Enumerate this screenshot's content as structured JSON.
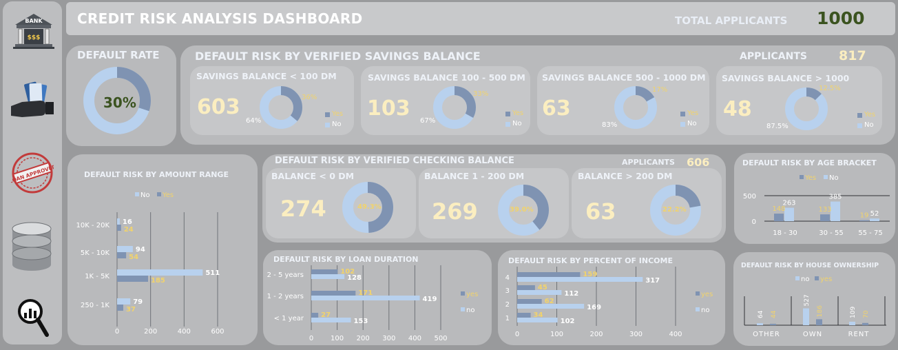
{
  "header": {
    "title": "CREDIT RISK ANALYSIS DASHBOARD",
    "total_label": "TOTAL APPLICANTS",
    "total_value": "1000"
  },
  "sidebar": {
    "bank_label": "BANK",
    "bank_symbol": "$$$",
    "stamp_text": "LOAN APPROVED"
  },
  "colors": {
    "no": "#b8d1ee",
    "yes": "#7f93b2",
    "yes_text": "#f1d36c",
    "value_text": "#fbeec0"
  },
  "default_rate": {
    "title": "DEFAULT RATE",
    "value": "30%"
  },
  "savings": {
    "title": "DEFAULT RISK BY VERIFIED SAVINGS BALANCE",
    "applicants_label": "APPLICANTS",
    "applicants_value": "817",
    "cards": [
      {
        "title": "SAVINGS BALANCE < 100 DM",
        "count": "603",
        "yes_pct": "36%",
        "no_pct": "64%",
        "yes_label": "Yes",
        "no_label": "No"
      },
      {
        "title": "SAVINGS BALANCE 100 - 500 DM",
        "count": "103",
        "yes_pct": "33%",
        "no_pct": "67%",
        "yes_label": "Yes",
        "no_label": "No"
      },
      {
        "title": "SAVINGS BALANCE 500 - 1000 DM",
        "count": "63",
        "yes_pct": "17%",
        "no_pct": "83%",
        "yes_label": "Yes",
        "no_label": "No"
      },
      {
        "title": "SAVINGS BALANCE > 1000",
        "count": "48",
        "yes_pct": "12.5%",
        "no_pct": "87.5%",
        "yes_label": "Yes",
        "no_label": "No"
      }
    ]
  },
  "checking": {
    "title": "DEFAULT RISK BY VERIFIED CHECKING BALANCE",
    "applicants_label": "APPLICANTS",
    "applicants_value": "606",
    "cards": [
      {
        "title": "BALANCE < 0 DM",
        "count": "274",
        "yes_pct": "49.3%"
      },
      {
        "title": "BALANCE 1 - 200 DM",
        "count": "269",
        "yes_pct": "39.0%"
      },
      {
        "title": "BALANCE > 200 DM",
        "count": "63",
        "yes_pct": "22.2%"
      }
    ]
  },
  "amount": {
    "title": "DEFAULT RISK BY AMOUNT RANGE",
    "legend_no": "No",
    "legend_yes": "Yes"
  },
  "duration": {
    "title": "DEFAULT RISK BY LOAN DURATION",
    "legend_yes": "yes",
    "legend_no": "no"
  },
  "income": {
    "title": "DEFAULT RISK BY PERCENT OF INCOME",
    "legend_yes": "yes",
    "legend_no": "no"
  },
  "age": {
    "title": "DEFAULT RISK BY AGE BRACKET",
    "legend_yes": "Yes",
    "legend_no": "No"
  },
  "house": {
    "title": "DEFAULT RISK BY HOUSE OWNERSHIP",
    "legend_no": "no",
    "legend_yes": "yes"
  },
  "chart_data": [
    {
      "type": "pie",
      "title": "DEFAULT RATE",
      "labels": [
        "Yes",
        "No"
      ],
      "values": [
        30,
        70
      ]
    },
    {
      "type": "pie",
      "title": "SAVINGS BALANCE < 100 DM",
      "labels": [
        "Yes",
        "No"
      ],
      "values": [
        36,
        64
      ]
    },
    {
      "type": "pie",
      "title": "SAVINGS BALANCE 100 - 500 DM",
      "labels": [
        "Yes",
        "No"
      ],
      "values": [
        33,
        67
      ]
    },
    {
      "type": "pie",
      "title": "SAVINGS BALANCE 500 - 1000 DM",
      "labels": [
        "Yes",
        "No"
      ],
      "values": [
        17,
        83
      ]
    },
    {
      "type": "pie",
      "title": "SAVINGS BALANCE > 1000",
      "labels": [
        "Yes",
        "No"
      ],
      "values": [
        12.5,
        87.5
      ]
    },
    {
      "type": "pie",
      "title": "BALANCE < 0 DM",
      "labels": [
        "Yes",
        "No"
      ],
      "values": [
        49.3,
        50.7
      ]
    },
    {
      "type": "pie",
      "title": "BALANCE 1 - 200 DM",
      "labels": [
        "Yes",
        "No"
      ],
      "values": [
        39.0,
        61.0
      ]
    },
    {
      "type": "pie",
      "title": "BALANCE > 200 DM",
      "labels": [
        "Yes",
        "No"
      ],
      "values": [
        22.2,
        77.8
      ]
    },
    {
      "type": "bar",
      "orientation": "horizontal",
      "title": "DEFAULT RISK BY AMOUNT RANGE",
      "categories": [
        "10K - 20K",
        "5K - 10K",
        "1K - 5K",
        "250 - 1K"
      ],
      "series": [
        {
          "name": "No",
          "values": [
            16,
            94,
            511,
            79
          ]
        },
        {
          "name": "Yes",
          "values": [
            24,
            54,
            185,
            37
          ]
        }
      ],
      "xlim": [
        0,
        600
      ],
      "xticks": [
        0,
        200,
        400,
        600
      ],
      "grid": true,
      "legend": "top"
    },
    {
      "type": "bar",
      "orientation": "horizontal",
      "title": "DEFAULT RISK BY LOAN DURATION",
      "categories": [
        "2 - 5 years",
        "1 - 2 years",
        "< 1 year"
      ],
      "series": [
        {
          "name": "yes",
          "values": [
            102,
            171,
            27
          ]
        },
        {
          "name": "no",
          "values": [
            128,
            419,
            153
          ]
        }
      ],
      "xlim": [
        0,
        500
      ],
      "xticks": [
        0,
        100,
        200,
        300,
        400,
        500
      ],
      "grid": true,
      "legend": "right"
    },
    {
      "type": "bar",
      "orientation": "horizontal",
      "title": "DEFAULT RISK BY PERCENT OF INCOME",
      "categories": [
        "4",
        "3",
        "2",
        "1"
      ],
      "series": [
        {
          "name": "yes",
          "values": [
            159,
            45,
            62,
            34
          ]
        },
        {
          "name": "no",
          "values": [
            317,
            112,
            169,
            102
          ]
        }
      ],
      "xlim": [
        0,
        400
      ],
      "xticks": [
        0,
        100,
        200,
        300,
        400
      ],
      "grid": true,
      "legend": "right"
    },
    {
      "type": "bar",
      "orientation": "vertical",
      "title": "DEFAULT RISK BY AGE BRACKET",
      "categories": [
        "18 - 30",
        "30 - 55",
        "55 - 75"
      ],
      "series": [
        {
          "name": "Yes",
          "values": [
            148,
            133,
            19
          ]
        },
        {
          "name": "No",
          "values": [
            263,
            385,
            52
          ]
        }
      ],
      "ylim": [
        0,
        500
      ],
      "yticks": [
        0,
        500
      ],
      "grid": true,
      "legend": "top"
    },
    {
      "type": "bar",
      "orientation": "vertical",
      "title": "DEFAULT RISK BY HOUSE OWNERSHIP",
      "categories": [
        "OTHER",
        "OWN",
        "RENT"
      ],
      "series": [
        {
          "name": "no",
          "values": [
            64,
            527,
            109
          ]
        },
        {
          "name": "yes",
          "values": [
            44,
            186,
            70
          ]
        }
      ],
      "ylim": [
        0,
        560
      ],
      "grid": true,
      "legend": "top"
    }
  ]
}
